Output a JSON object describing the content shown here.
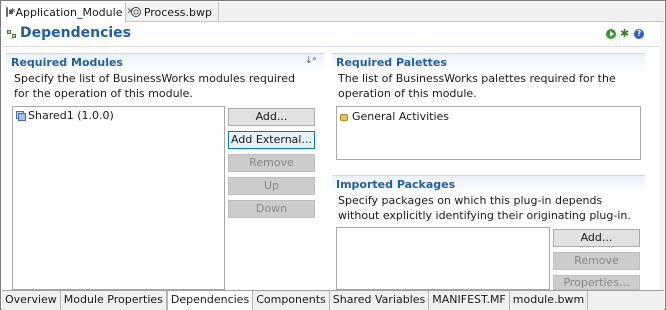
{
  "editor_tabs": [
    {
      "label": "*Application_Module",
      "close": "✕"
    },
    {
      "label": "Process.bwp"
    }
  ],
  "header": {
    "title": "Dependencies"
  },
  "required_modules": {
    "title": "Required Modules",
    "description": "Specify the list of BusinessWorks modules required for the operation of this module.",
    "items": [
      "Shared1 (1.0.0)"
    ],
    "buttons": {
      "add": "Add...",
      "add_external": "Add External...",
      "remove": "Remove",
      "up": "Up",
      "down": "Down"
    }
  },
  "required_palettes": {
    "title": "Required Palettes",
    "description": "The list of BusinessWorks palettes required for the operation of this module.",
    "items": [
      "General Activities"
    ]
  },
  "imported_packages": {
    "title": "Imported Packages",
    "description": "Specify packages on which this plug-in depends without explicitly identifying their originating plug-in.",
    "buttons": {
      "add": "Add...",
      "remove": "Remove",
      "properties": "Properties..."
    }
  },
  "bottom_tabs": [
    "Overview",
    "Module Properties",
    "Dependencies",
    "Components",
    "Shared Variables",
    "MANIFEST.MF",
    "module.bwm"
  ],
  "active_bottom_tab": "Dependencies",
  "colors": {
    "accent": "#1f5faa",
    "focus_border": "#0078d7"
  }
}
